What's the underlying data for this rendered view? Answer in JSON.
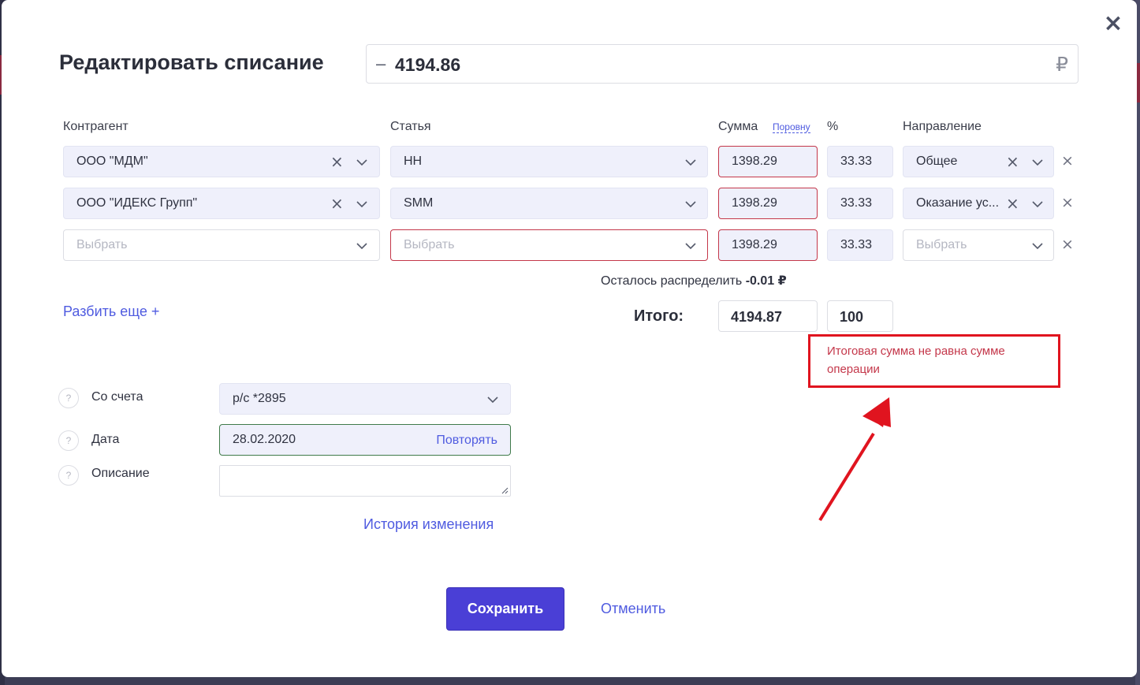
{
  "dialog": {
    "title": "Редактировать списание",
    "amount_sign": "–",
    "amount": "4194.86",
    "currency_symbol": "₽"
  },
  "columns": {
    "counterparty": "Контрагент",
    "article": "Статья",
    "sum": "Сумма",
    "equal_split": "Поровну",
    "percent": "%",
    "direction": "Направление"
  },
  "rows": [
    {
      "counterparty": "ООО \"МДМ\"",
      "article": "НН",
      "sum": "1398.29",
      "percent": "33.33",
      "direction": "Общее"
    },
    {
      "counterparty": "ООО \"ИДЕКС Групп\"",
      "article": "SMM",
      "sum": "1398.29",
      "percent": "33.33",
      "direction": "Оказание ус..."
    },
    {
      "counterparty_placeholder": "Выбрать",
      "article_placeholder": "Выбрать",
      "sum": "1398.29",
      "percent": "33.33",
      "direction_placeholder": "Выбрать"
    }
  ],
  "remaining": {
    "label": "Осталось распределить",
    "value": "-0.01 ₽"
  },
  "split_more": "Разбить еще +",
  "totals": {
    "label": "Итого:",
    "sum": "4194.87",
    "percent": "100"
  },
  "error_message": "Итоговая сумма не равна сумме операции",
  "form": {
    "account_label": "Со счета",
    "account_value": "р/с *2895",
    "date_label": "Дата",
    "date_value": "28.02.2020",
    "repeat_label": "Повторять",
    "description_label": "Описание",
    "description_value": "",
    "help_glyph": "?"
  },
  "history_link": "История изменения",
  "buttons": {
    "save": "Сохранить",
    "cancel": "Отменить"
  },
  "colors": {
    "accent": "#4a3fd6",
    "link": "#4f5be0",
    "error": "#c4374a",
    "annotation": "#e0141f",
    "field_bg": "#eff0fb"
  },
  "icons": {
    "close": "close-icon",
    "clear": "clear-x-icon",
    "chevron": "chevron-down-icon",
    "remove_row": "remove-row-icon",
    "help": "help-icon"
  }
}
